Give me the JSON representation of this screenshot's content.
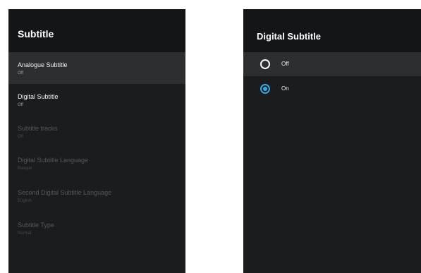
{
  "subtitle_menu": {
    "title": "Subtitle",
    "items": [
      {
        "label": "Analogue Subtitle",
        "value": "Off"
      },
      {
        "label": "Digital Subtitle",
        "value": "Off"
      },
      {
        "label": "Subtitle tracks",
        "value": "Off"
      },
      {
        "label": "Digital Subtitle Language",
        "value": "Basque"
      },
      {
        "label": "Second Digital Subtitle Language",
        "value": "English"
      },
      {
        "label": "Subtitle Type",
        "value": "Normal"
      }
    ]
  },
  "digital_subtitle_dialog": {
    "title": "Digital Subtitle",
    "options": [
      {
        "label": "Off",
        "selected": false
      },
      {
        "label": "On",
        "selected": true
      }
    ]
  },
  "colors": {
    "panel_bg": "#1b1c1e",
    "header_bg": "#141517",
    "focus_bg": "#2d2e30",
    "accent": "#38a8e8"
  }
}
